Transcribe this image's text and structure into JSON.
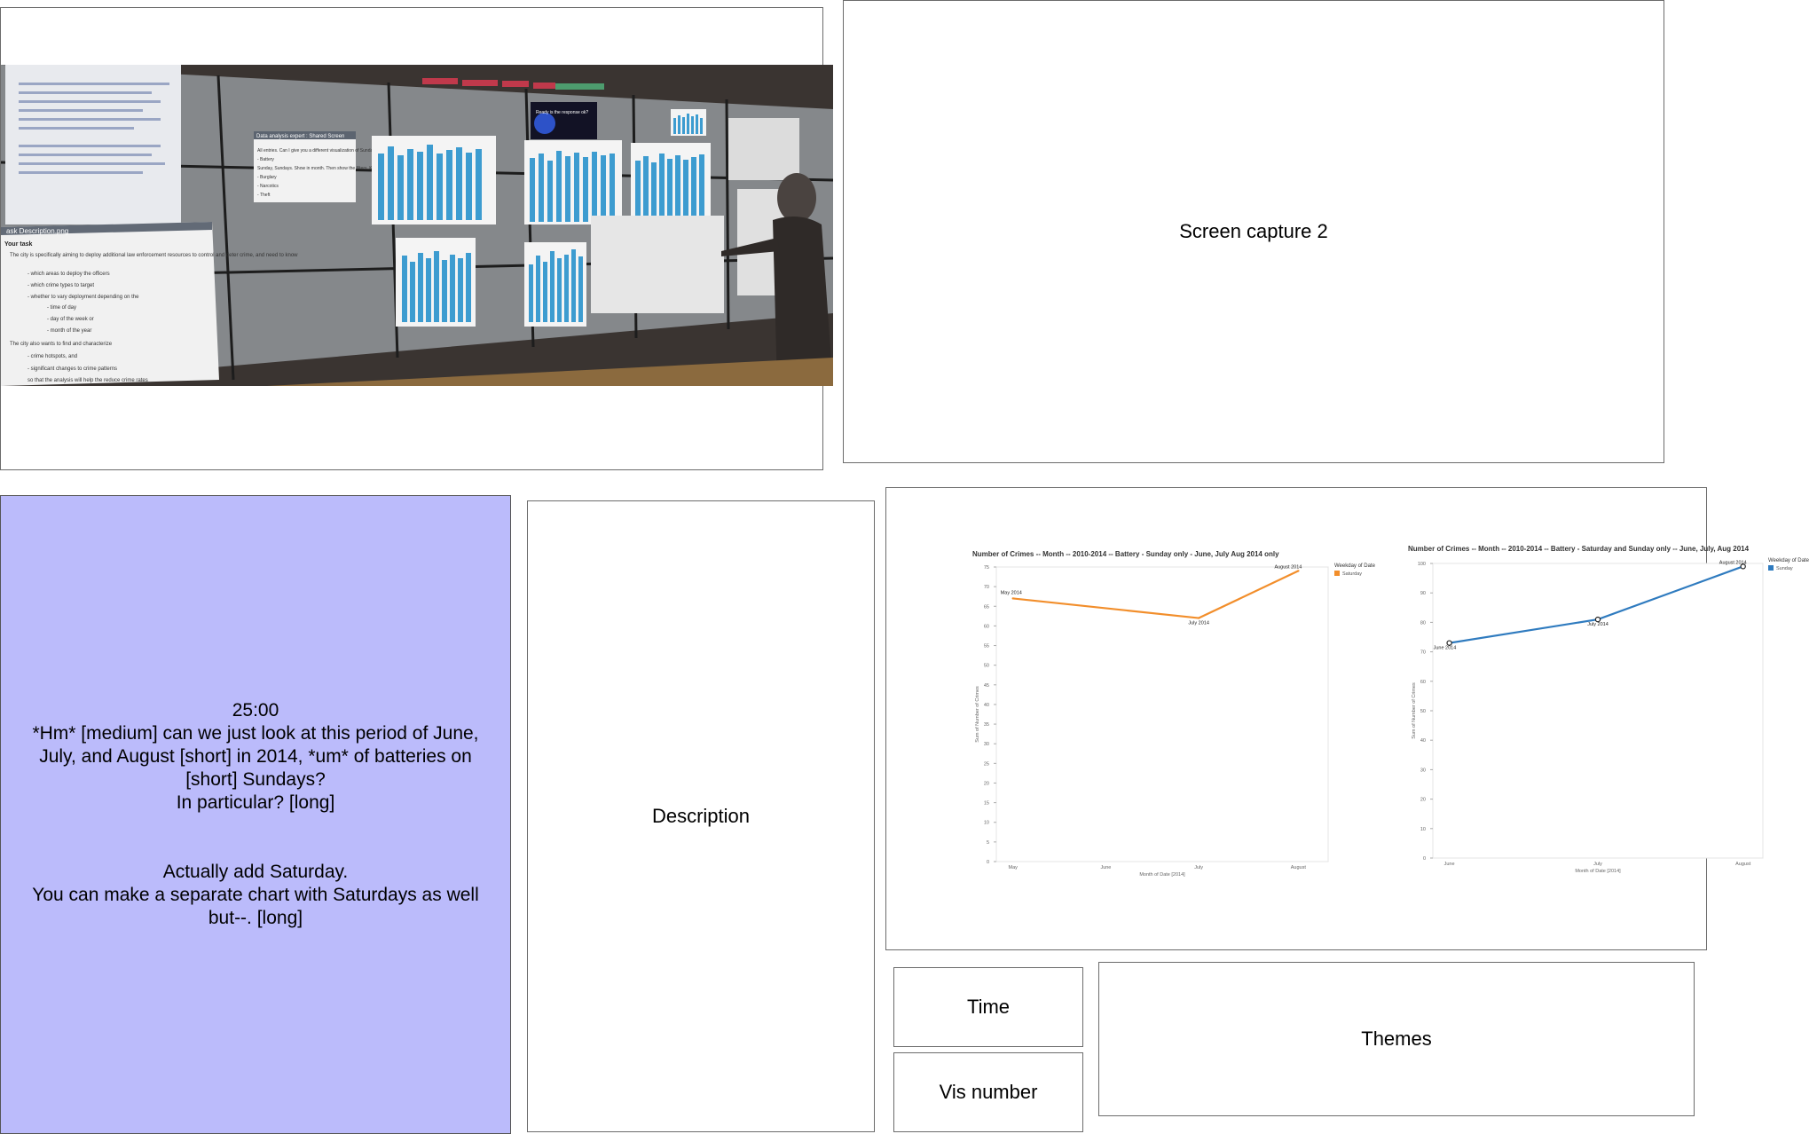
{
  "panels": {
    "screen_capture_2": "Screen capture 2",
    "description": "Description",
    "time": "Time",
    "vis_number": "Vis number",
    "themes": "Themes"
  },
  "transcript": {
    "timestamp": "25:00",
    "lines": [
      "*Hm* [medium] can we just look at this period of June,",
      "July, and August [short] in 2014, *um* of batteries on",
      "[short] Sundays?",
      "In particular? [long]"
    ],
    "lines_2": [
      "Actually add Saturday.",
      "You can make a separate chart with Saturdays as well",
      "but--. [long]"
    ]
  },
  "photo": {
    "window_title": "ask Description.png",
    "heading": "Your task",
    "task_lines": [
      "The city is specifically aiming to deploy additional law enforcement resources to control and deter crime, and need to know",
      "- which areas to deploy the officers",
      "- which crime types to target",
      "- whether to vary deployment depending on the",
      "- time of day",
      "- day of the week or",
      "- month of the year",
      "The city also wants to find and characterize",
      "- crime hotspots, and",
      "- significant changes to crime patterns",
      "so that the analysis will help the reduce crime rates"
    ],
    "assistant_title": "Data analysis expert : Shared Screen",
    "assistant_lines": [
      "All entries. Can I give you a different visualization of Sunday",
      "- Battery",
      "Sunday, Sundays. Show in month. Then show the filters. Keep it short hence they are.",
      "- Burglary",
      "- Narcotics",
      "- Theft"
    ],
    "overlay_question": "Ready is the response ok?"
  },
  "chart_data": [
    {
      "type": "line",
      "title": "Number of Crimes -- Month -- 2010-2014 -- Battery - Sunday only - June, July Aug 2014 only",
      "xlabel": "Month of Date [2014]",
      "ylabel": "Sum of Number of Crimes",
      "categories": [
        "May",
        "June",
        "July",
        "August"
      ],
      "yticks": [
        0,
        5,
        10,
        15,
        20,
        25,
        30,
        35,
        40,
        45,
        50,
        55,
        60,
        65,
        70,
        75
      ],
      "ylim": [
        0,
        75
      ],
      "legend_title": "Weekday of Date",
      "legend_placement": "right",
      "color": "#f28e2b",
      "series": [
        {
          "name": "Saturday",
          "points": [
            {
              "x": "May",
              "y": 67,
              "label": "May 2014"
            },
            {
              "x": "July",
              "y": 62,
              "label": "July 2014"
            },
            {
              "x": "August",
              "y": 74,
              "label": "August 2014"
            }
          ]
        }
      ]
    },
    {
      "type": "line",
      "title": "Number of Crimes -- Month -- 2010-2014 -- Battery - Saturday and Sunday only -- June, July, Aug 2014",
      "xlabel": "Month of Date [2014]",
      "ylabel": "Sum of Number of Crimes",
      "categories": [
        "June",
        "July",
        "August"
      ],
      "yticks": [
        0,
        10,
        20,
        30,
        40,
        50,
        60,
        70,
        80,
        90,
        100
      ],
      "ylim": [
        0,
        100
      ],
      "legend_title": "Weekday of Date",
      "legend_placement": "right",
      "color": "#2f7bbf",
      "series": [
        {
          "name": "Sunday",
          "points": [
            {
              "x": "June",
              "y": 73,
              "label": "June 2014"
            },
            {
              "x": "July",
              "y": 81,
              "label": "July 2014"
            },
            {
              "x": "August",
              "y": 99,
              "label": "August 2014"
            }
          ]
        }
      ]
    }
  ]
}
